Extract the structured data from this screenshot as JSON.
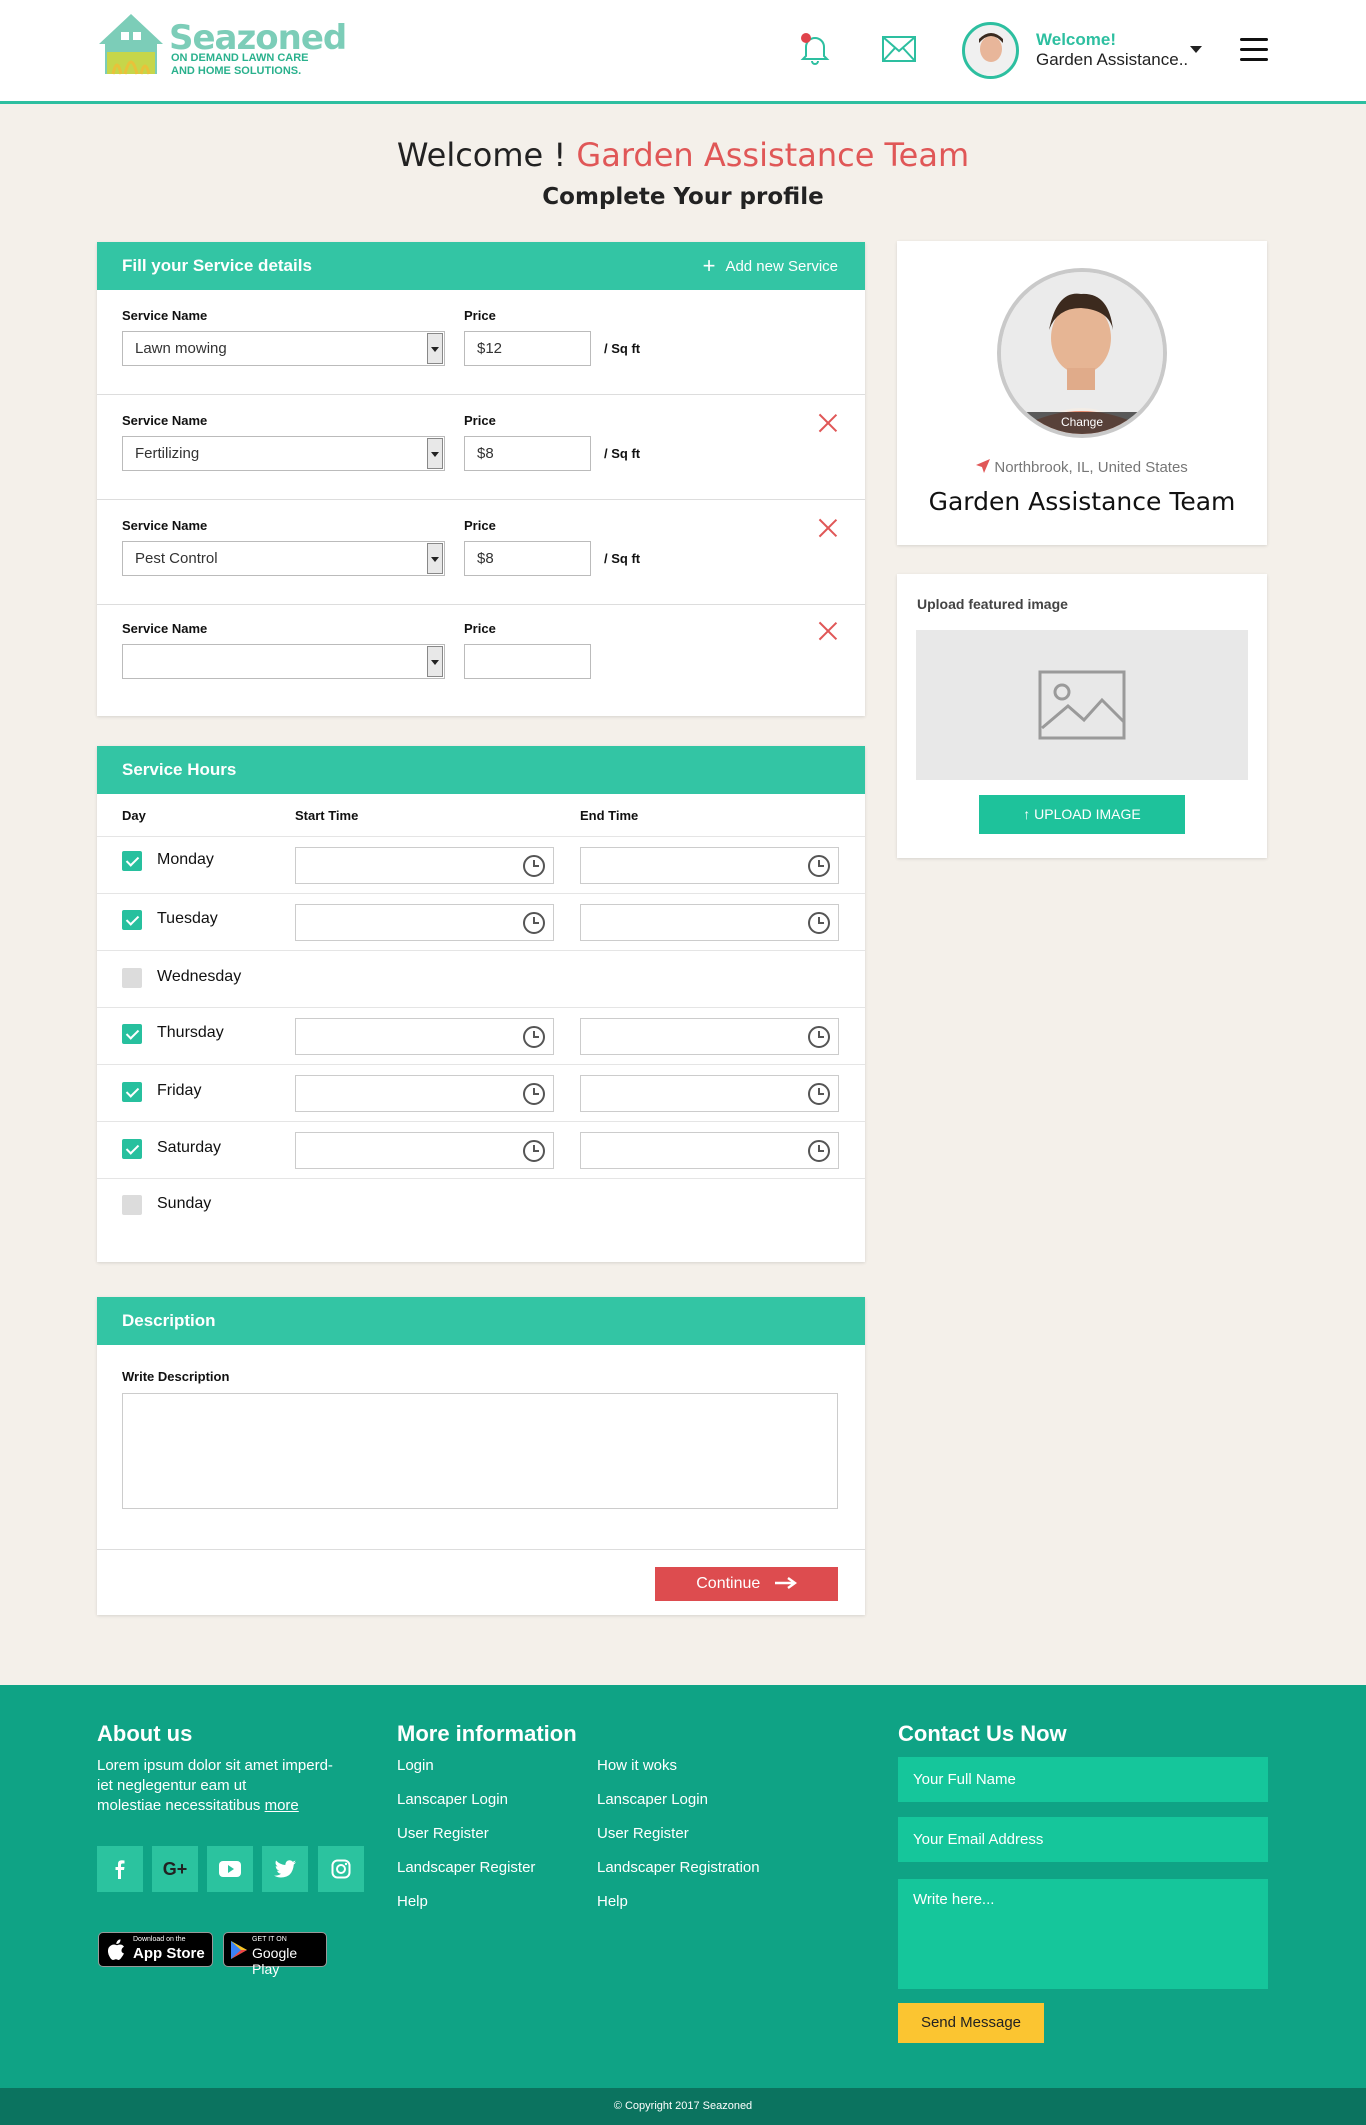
{
  "header": {
    "logo_name": "Seazoned",
    "logo_tagline": "ON DEMAND LAWN CARE AND HOME SOLUTIONS.",
    "welcome_label": "Welcome!",
    "user_name": "Garden Assistance..",
    "icons": [
      "bell-icon",
      "mail-icon",
      "menu-icon"
    ]
  },
  "page": {
    "welcome_prefix": "Welcome !",
    "team_name": "Garden Assistance Team",
    "subtitle": "Complete Your profile"
  },
  "services": {
    "title": "Fill your Service details",
    "add_label": "Add new Service",
    "service_name_label": "Service Name",
    "price_label": "Price",
    "unit": "/ Sq ft",
    "rows": [
      {
        "service": "Lawn mowing",
        "price": "$12",
        "unit": "/ Sq ft"
      },
      {
        "service": "Fertilizing",
        "price": "$8",
        "unit": "/ Sq ft"
      },
      {
        "service": "Pest Control",
        "price": "$8",
        "unit": "/ Sq ft"
      },
      {
        "service": "",
        "price": "",
        "unit": ""
      }
    ]
  },
  "hours": {
    "title": "Service Hours",
    "col_day": "Day",
    "col_start": "Start Time",
    "col_end": "End Time",
    "days": [
      {
        "name": "Monday",
        "checked": true
      },
      {
        "name": "Tuesday",
        "checked": true
      },
      {
        "name": "Wednesday",
        "checked": false
      },
      {
        "name": "Thursday",
        "checked": true
      },
      {
        "name": "Friday",
        "checked": true
      },
      {
        "name": "Saturday",
        "checked": true
      },
      {
        "name": "Sunday",
        "checked": false
      }
    ]
  },
  "description": {
    "title": "Description",
    "label": "Write Description",
    "continue": "Continue"
  },
  "profile": {
    "change": "Change",
    "location": "Northbrook, IL, United States",
    "name": "Garden Assistance Team"
  },
  "upload": {
    "title": "Upload featured image",
    "button": "UPLOAD IMAGE"
  },
  "footer": {
    "about_title": "About us",
    "about_text_1": "Lorem ipsum dolor sit amet imperd-",
    "about_text_2": "iet neglegentur eam ut",
    "about_text_3": "molestiae necessitatibus",
    "about_more": "more",
    "social": [
      "facebook-icon",
      "google-plus-icon",
      "youtube-icon",
      "twitter-icon",
      "instagram-icon"
    ],
    "appstore_small": "Download on the",
    "appstore_big": "App Store",
    "gplay_small": "GET IT ON",
    "gplay_big": "Google Play",
    "info_title": "More information",
    "links_col1": [
      "Login",
      "Lanscaper Login",
      "User Register",
      "Landscaper Register",
      "Help"
    ],
    "links_col2": [
      "How it woks",
      "Lanscaper Login",
      "User Register",
      "Landscaper Registration",
      "Help"
    ],
    "contact_title": "Contact Us Now",
    "name_placeholder": "Your Full Name",
    "email_placeholder": "Your Email Address",
    "message_placeholder": "Write here...",
    "send": "Send Message",
    "copyright": "© Copyright 2017 Seazoned"
  },
  "colors": {
    "accent": "#33c5a4",
    "red": "#dd4c4f",
    "footer": "#0fa385",
    "yellow": "#fbc531"
  }
}
